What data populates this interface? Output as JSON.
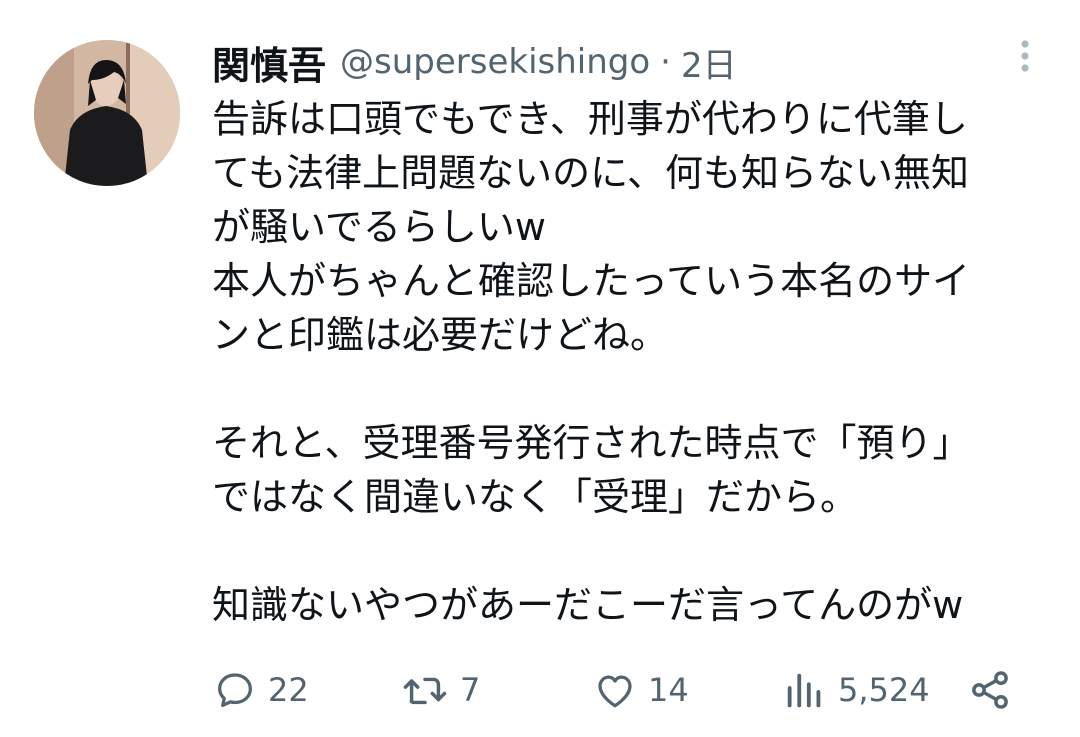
{
  "tweet": {
    "author": {
      "display_name": "関慎吾",
      "handle": "@supersekishingo",
      "separator": "·",
      "time": "2日"
    },
    "text_lines": [
      "告訴は口頭でもでき、刑事が代わりに代筆し",
      "ても法律上問題ないのに、何も知らない無知",
      "が騒いでるらしいw",
      "本人がちゃんと確認したっていう本名のサイ",
      "ンと印鑑は必要だけどね。",
      "",
      "それと、受理番号発行された時点で「預り」",
      "ではなく間違いなく「受理」だから。",
      "",
      "知識ないやつがあーだこーだ言ってんのがw"
    ],
    "metrics": {
      "replies": "22",
      "retweets": "7",
      "likes": "14",
      "views": "5,524"
    },
    "icons": {
      "more": "more-vertical-icon",
      "reply": "reply-icon",
      "retweet": "retweet-icon",
      "like": "heart-icon",
      "views": "views-icon",
      "share": "share-icon"
    },
    "colors": {
      "text": "#0f1419",
      "secondary": "#536471",
      "more_dots": "#aab8c2"
    }
  }
}
